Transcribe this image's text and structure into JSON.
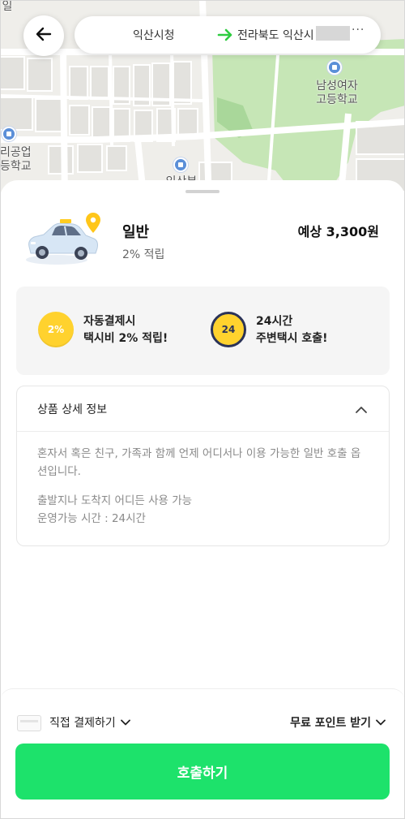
{
  "map": {
    "labels": {
      "top_left": "일",
      "left_school": "리공업\n등학교",
      "right_school": "남성여자\n고등학교",
      "bottom_place": "익산부"
    }
  },
  "header": {
    "origin": "익산시청",
    "destination": "전라북도 익산시",
    "more": "···"
  },
  "service": {
    "name": "일반",
    "reward": "2% 적립",
    "fare": "예상 3,300원"
  },
  "benefits": [
    {
      "badge": "2%",
      "line1": "자동결제시",
      "line2": "택시비 2% 적립!"
    },
    {
      "badge": "24",
      "line1": "24시간",
      "line2": "주변택시 호출!"
    }
  ],
  "details": {
    "title": "상품 상세 정보",
    "description": "혼자서 혹은 친구, 가족과 함께 언제 어디서나 이용 가능한 일반 호출 옵션입니다.",
    "usage": "출발지나 도착지 어디든 사용 가능",
    "hours": "운영가능 시간 : 24시간"
  },
  "footer": {
    "payment_method": "직접 결제하기",
    "free_points": "무료 포인트 받기",
    "call_button": "호출하기"
  },
  "colors": {
    "primary_green": "#1de26b",
    "coin_yellow": "#ffd22e",
    "route_arrow": "#2ecc40",
    "map_park": "#c6e6b6",
    "pin_blue": "#5b8fd8"
  },
  "icons": [
    "back-arrow-icon",
    "route-arrow-icon",
    "chevron-up-icon",
    "chevron-down-icon",
    "card-icon",
    "taxi-icon",
    "location-pin-icon"
  ]
}
